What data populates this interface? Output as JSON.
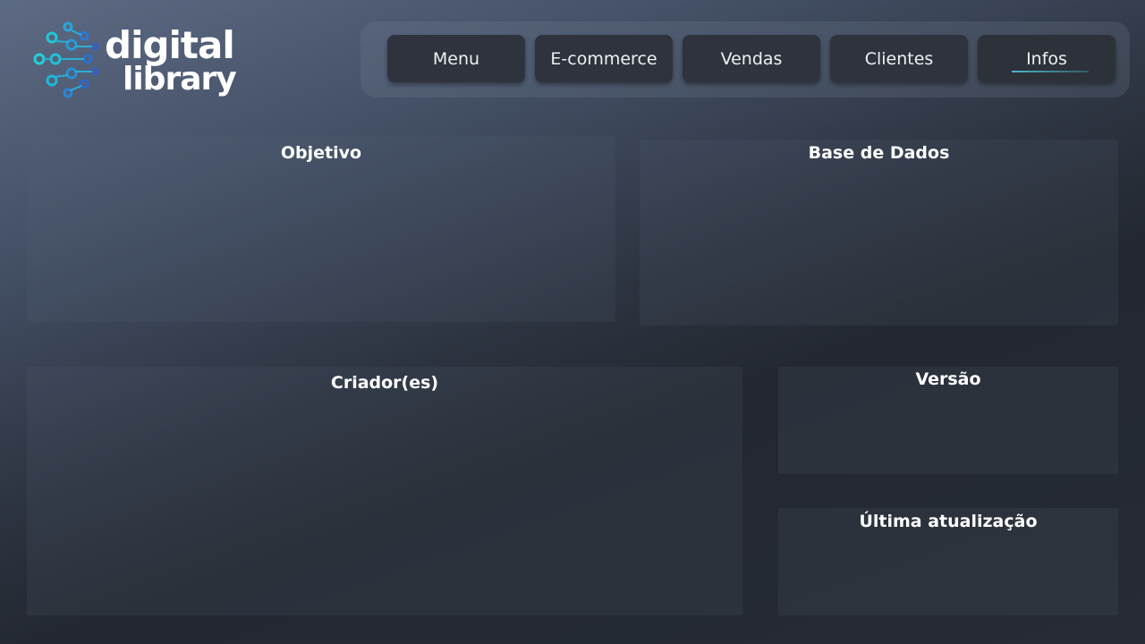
{
  "logo": {
    "word1": "digital",
    "word2": "library"
  },
  "nav": {
    "items": [
      {
        "label": "Menu"
      },
      {
        "label": "E-commerce"
      },
      {
        "label": "Vendas"
      },
      {
        "label": "Clientes"
      },
      {
        "label": "Infos"
      }
    ],
    "active": "Infos"
  },
  "panels": {
    "objetivo": "Objetivo",
    "base_dados": "Base de Dados",
    "criadores": "Criador(es)",
    "versao": "Versão",
    "ultima_atualizacao": "Última atualização"
  },
  "colors": {
    "accent": "#4fb6c9",
    "nav_button": "#2f333d"
  }
}
